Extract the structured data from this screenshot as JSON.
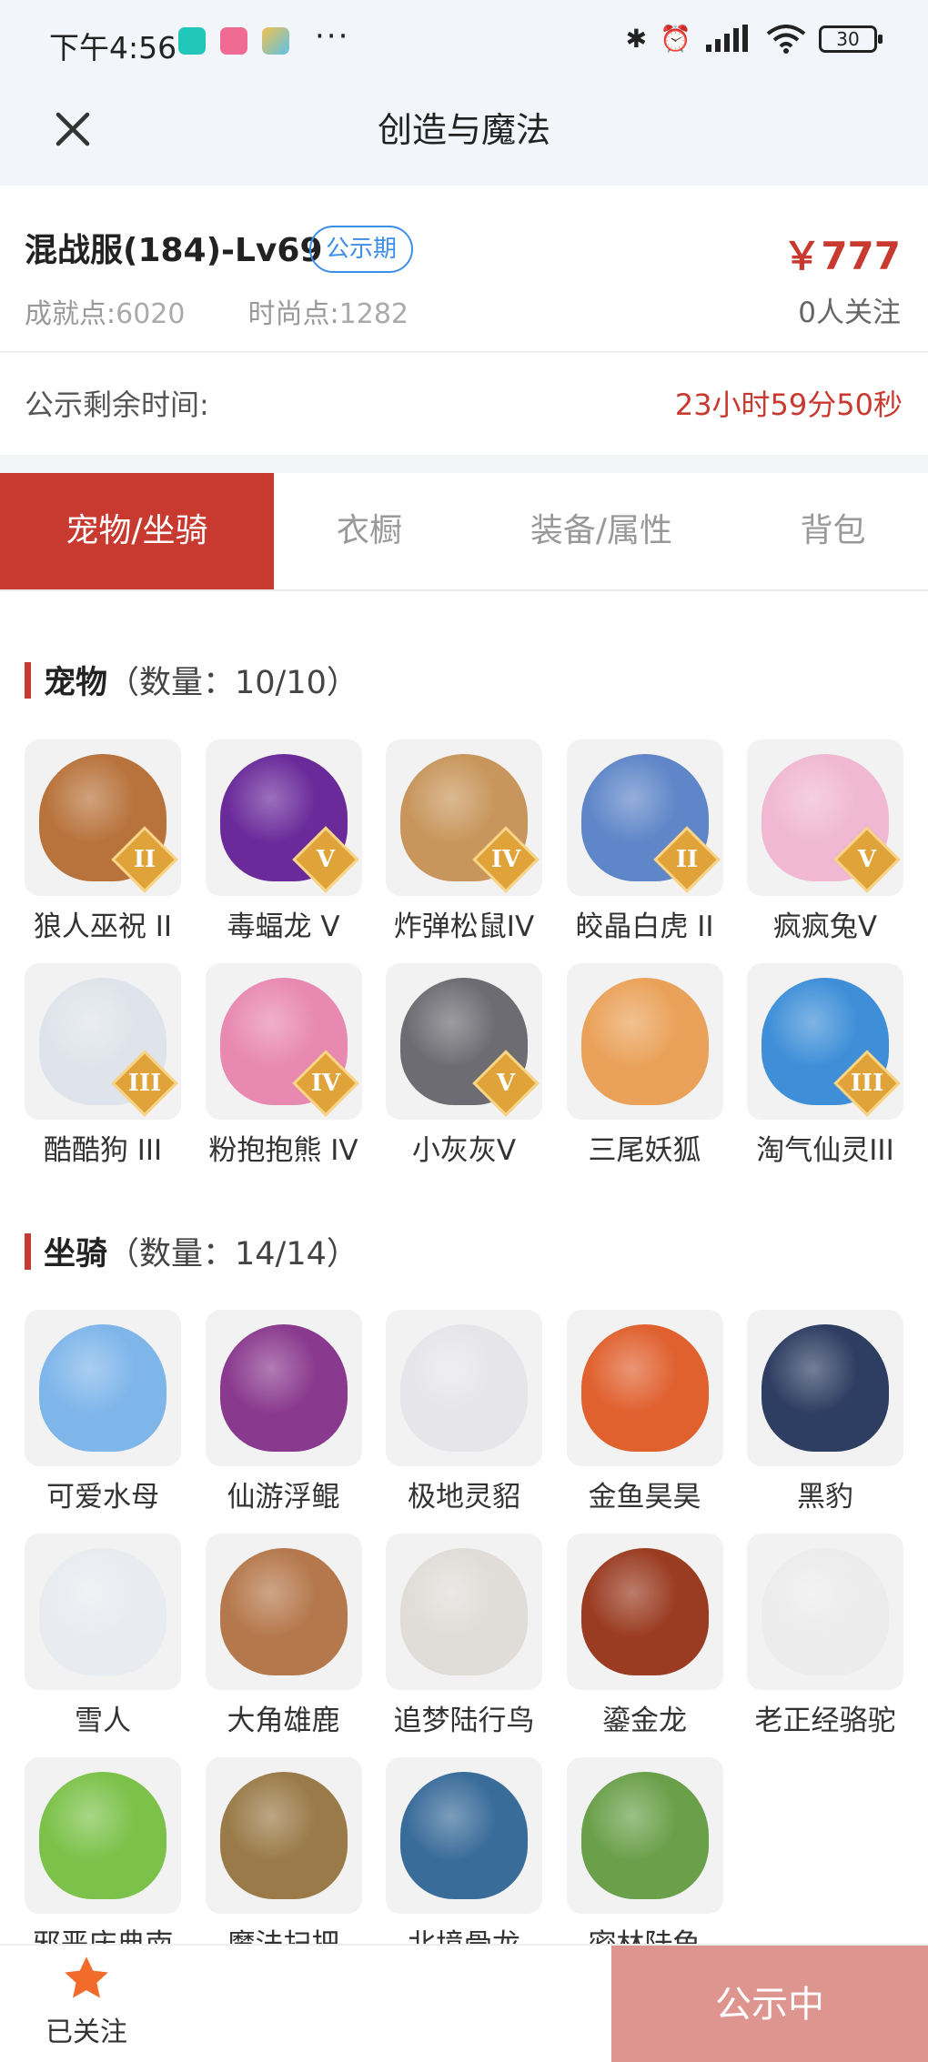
{
  "status_bar": {
    "time": "下午4:56",
    "battery": "30"
  },
  "header": {
    "title": "创造与魔法"
  },
  "account": {
    "server": "混战服(184)-Lv69",
    "badge": "公示期",
    "price": "￥777",
    "achievement_label": "成就点:",
    "achievement_value": "6020",
    "fashion_label": "时尚点:",
    "fashion_value": "1282",
    "followers": "0人关注"
  },
  "countdown": {
    "label": "公示剩余时间:",
    "value": "23小时59分50秒"
  },
  "tabs": [
    {
      "label": "宠物/坐骑",
      "active": true
    },
    {
      "label": "衣橱",
      "active": false
    },
    {
      "label": "装备/属性",
      "active": false
    },
    {
      "label": "背包",
      "active": false
    }
  ],
  "pets": {
    "title": "宠物",
    "count": "（数量：10/10）",
    "items": [
      {
        "name": "狼人巫祝 II",
        "tier": "II",
        "color": "#b8733c"
      },
      {
        "name": "毒蝠龙 V",
        "tier": "V",
        "color": "#6a2a9a"
      },
      {
        "name": "炸弹松鼠IV",
        "tier": "IV",
        "color": "#c8965c"
      },
      {
        "name": "皎晶白虎 II",
        "tier": "II",
        "color": "#5f86c8"
      },
      {
        "name": "疯疯兔V",
        "tier": "V",
        "color": "#f0b8d2"
      },
      {
        "name": "酷酷狗 III",
        "tier": "III",
        "color": "#dfe4ec"
      },
      {
        "name": "粉抱抱熊 IV",
        "tier": "IV",
        "color": "#e889b2"
      },
      {
        "name": "小灰灰V",
        "tier": "V",
        "color": "#6c6c72"
      },
      {
        "name": "三尾妖狐",
        "tier": "",
        "color": "#eaa25a"
      },
      {
        "name": "淘气仙灵III",
        "tier": "III",
        "color": "#3e8fd8"
      }
    ]
  },
  "mounts": {
    "title": "坐骑",
    "count": "（数量：14/14）",
    "items": [
      {
        "name": "可爱水母",
        "color": "#7fb6ea"
      },
      {
        "name": "仙游浮鲲",
        "color": "#8a3a8e"
      },
      {
        "name": "极地灵貂",
        "color": "#e6e6ea"
      },
      {
        "name": "金鱼昊昊",
        "color": "#e0602e"
      },
      {
        "name": "黑豹",
        "color": "#2e3e62"
      },
      {
        "name": "雪人",
        "color": "#e8ecf0"
      },
      {
        "name": "大角雄鹿",
        "color": "#b5784c"
      },
      {
        "name": "追梦陆行鸟",
        "color": "#e0dcd8"
      },
      {
        "name": "鎏金龙",
        "color": "#9a3c22"
      },
      {
        "name": "老正经骆驼",
        "color": "#ececec"
      },
      {
        "name": "邪恶庆典南",
        "color": "#7cc24a"
      },
      {
        "name": "魔法扫把",
        "color": "#9a7a48"
      },
      {
        "name": "北境骨龙",
        "color": "#3a6c9a"
      },
      {
        "name": "密林陆龟",
        "color": "#6aa04a"
      }
    ]
  },
  "bottom": {
    "follow_label": "已关注",
    "action_label": "公示中"
  },
  "colors": {
    "accent": "#c8392f",
    "badge_blue": "#3d8ee8",
    "action_bg": "#de9590",
    "star": "#f26b2a"
  }
}
